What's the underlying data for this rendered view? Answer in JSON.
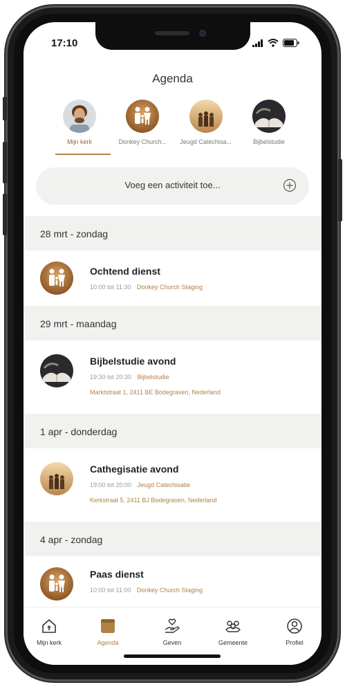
{
  "status": {
    "time": "17:10"
  },
  "header": {
    "title": "Agenda"
  },
  "groups": [
    {
      "label": "Mijn kerk",
      "icon": "person-photo-avatar",
      "active": true
    },
    {
      "label": "Donkey Church...",
      "icon": "family-icon-avatar",
      "active": false
    },
    {
      "label": "Jeugd Catechisa...",
      "icon": "group-photo-avatar",
      "active": false
    },
    {
      "label": "Bijbelstudie",
      "icon": "bible-photo-avatar",
      "active": false
    }
  ],
  "add_activity": {
    "label": "Voeg een activiteit toe...",
    "icon": "plus-circle-icon"
  },
  "days": [
    {
      "header": "28 mrt - zondag"
    },
    {
      "header": "29 mrt - maandag"
    },
    {
      "header": "1 apr - donderdag"
    },
    {
      "header": "4 apr - zondag"
    }
  ],
  "events": [
    {
      "title": "Ochtend dienst",
      "time": "10:00 tot 11:30",
      "group": "Donkey Church Staging",
      "address": ""
    },
    {
      "title": "Bijbelstudie avond",
      "time": "19:30 tot 20:30",
      "group": "Bijbelstudie",
      "address": "Marktstraat 1, 2411 BE Bodegraven, Nederland"
    },
    {
      "title": "Cathegisatie avond",
      "time": "19:00 tot 20:00",
      "group": "Jeugd Catechisatie",
      "address": "Kerkstraat 5, 2411 BJ Bodegraven, Nederland"
    },
    {
      "title": "Paas dienst",
      "time": "10:00 tot 11:00",
      "group": "Donkey Church Staging",
      "address": ""
    }
  ],
  "tabbar": [
    {
      "label": "Mijn kerk",
      "icon": "home-icon",
      "active": false
    },
    {
      "label": "Agenda",
      "icon": "calendar-icon",
      "active": true
    },
    {
      "label": "Geven",
      "icon": "giving-hand-icon",
      "active": false
    },
    {
      "label": "Gemeente",
      "icon": "community-icon",
      "active": false
    },
    {
      "label": "Profiel",
      "icon": "profile-icon",
      "active": false
    }
  ],
  "colors": {
    "accent": "#b08246",
    "background": "#f1f1ef",
    "text": "#222222"
  }
}
